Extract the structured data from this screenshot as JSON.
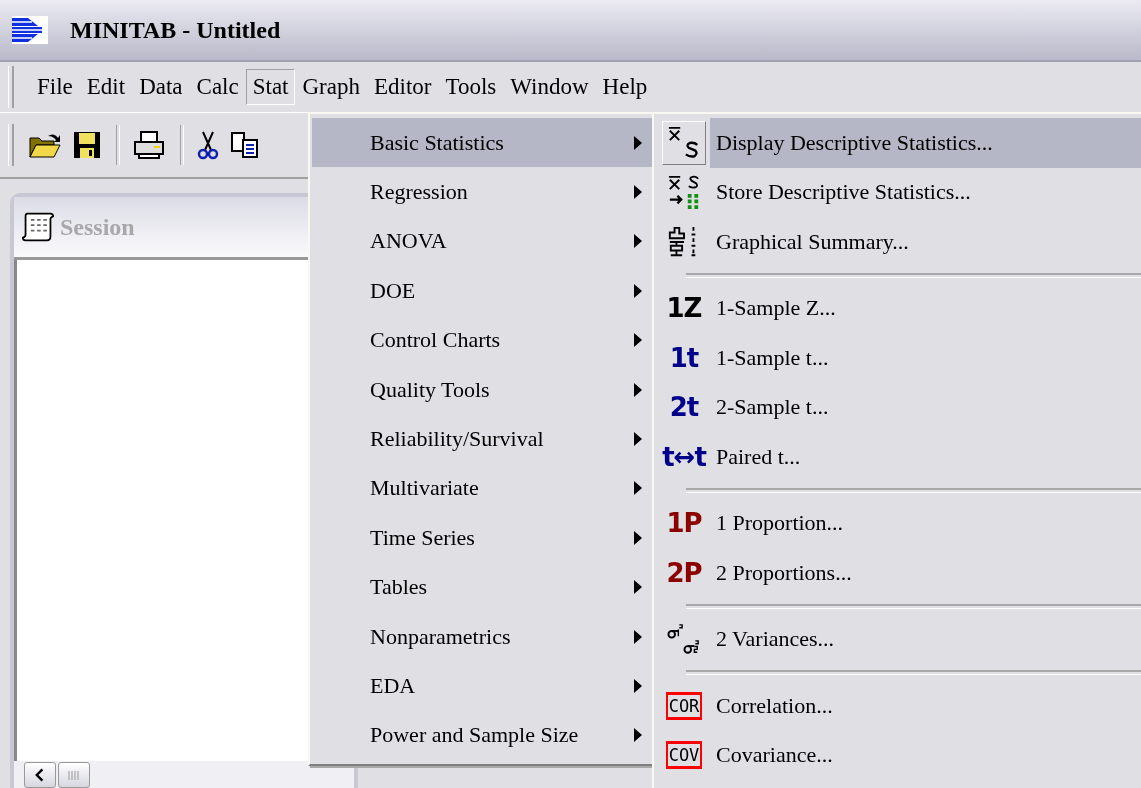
{
  "window": {
    "title": "MINITAB - Untitled"
  },
  "menu_bar": [
    {
      "label": "File",
      "selected": false
    },
    {
      "label": "Edit",
      "selected": false
    },
    {
      "label": "Data",
      "selected": false
    },
    {
      "label": "Calc",
      "selected": false
    },
    {
      "label": "Stat",
      "selected": true
    },
    {
      "label": "Graph",
      "selected": false
    },
    {
      "label": "Editor",
      "selected": false
    },
    {
      "label": "Tools",
      "selected": false
    },
    {
      "label": "Window",
      "selected": false
    },
    {
      "label": "Help",
      "selected": false
    }
  ],
  "toolbar": [
    {
      "kind": "open"
    },
    {
      "kind": "save"
    },
    {
      "kind": "sep"
    },
    {
      "kind": "print"
    },
    {
      "kind": "sep"
    },
    {
      "kind": "cut"
    },
    {
      "kind": "copy"
    }
  ],
  "session_window": {
    "title": "Session"
  },
  "stat_menu": [
    {
      "label": "Basic Statistics",
      "selected": true
    },
    {
      "label": "Regression",
      "selected": false
    },
    {
      "label": "ANOVA",
      "selected": false
    },
    {
      "label": "DOE",
      "selected": false
    },
    {
      "label": "Control Charts",
      "selected": false
    },
    {
      "label": "Quality Tools",
      "selected": false
    },
    {
      "label": "Reliability/Survival",
      "selected": false
    },
    {
      "label": "Multivariate",
      "selected": false
    },
    {
      "label": "Time Series",
      "selected": false
    },
    {
      "label": "Tables",
      "selected": false
    },
    {
      "label": "Nonparametrics",
      "selected": false
    },
    {
      "label": "EDA",
      "selected": false
    },
    {
      "label": "Power and Sample Size",
      "selected": false
    }
  ],
  "basic_statistics_menu": [
    {
      "kind": "display",
      "label": "Display Descriptive Statistics...",
      "selected": true
    },
    {
      "kind": "store",
      "label": "Store Descriptive Statistics...",
      "selected": false
    },
    {
      "kind": "graphical",
      "label": "Graphical Summary...",
      "selected": false
    },
    {
      "kind": "separator"
    },
    {
      "kind": "glyph",
      "icon": "1Z",
      "color": "#000000",
      "label": "1-Sample Z...",
      "selected": false
    },
    {
      "kind": "glyph",
      "icon": "1t",
      "color": "#00008b",
      "label": "1-Sample t...",
      "selected": false
    },
    {
      "kind": "glyph",
      "icon": "2t",
      "color": "#00008b",
      "label": "2-Sample t...",
      "selected": false
    },
    {
      "kind": "glyph",
      "icon": "t↔t",
      "color": "#00008b",
      "label": "Paired t...",
      "selected": false
    },
    {
      "kind": "separator"
    },
    {
      "kind": "glyph",
      "icon": "1P",
      "color": "#8b0000",
      "label": "1 Proportion...",
      "selected": false
    },
    {
      "kind": "glyph",
      "icon": "2P",
      "color": "#8b0000",
      "label": "2 Proportions...",
      "selected": false
    },
    {
      "kind": "separator"
    },
    {
      "kind": "variance",
      "label": "2 Variances...",
      "selected": false
    },
    {
      "kind": "separator"
    },
    {
      "kind": "bracket",
      "icon": "COR",
      "label": "Correlation...",
      "selected": false
    },
    {
      "kind": "bracket",
      "icon": "COV",
      "label": "Covariance...",
      "selected": false
    }
  ]
}
